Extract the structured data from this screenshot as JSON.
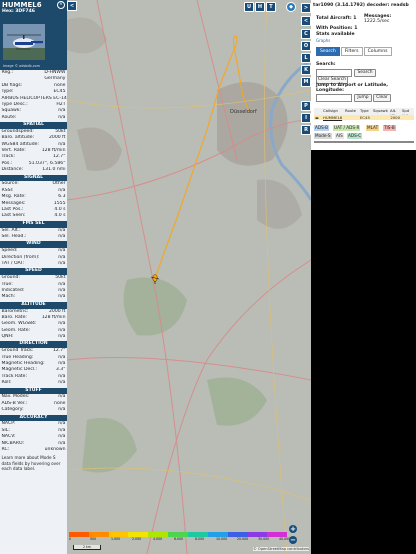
{
  "info": {
    "callsign": "HUMMEL6",
    "hex_label": "Hex:",
    "hex": "3DF746",
    "image_credit": "Image © adsbdb.com",
    "close_glyph": "×",
    "fields": [
      {
        "label": "Reg.:",
        "value": "D-HNWW"
      },
      {
        "label": "",
        "value": "Germany"
      },
      {
        "label": "DB flags:",
        "value": "none"
      },
      {
        "label": "Type:",
        "value": "EC45"
      },
      {
        "label": "AIRBUS HELICOPTERS EC-145",
        "value": ""
      },
      {
        "label": "Type Desc.:",
        "value": "H2T"
      },
      {
        "label": "Squawk:",
        "value": "n/a"
      },
      {
        "label": "Route:",
        "value": "n/a"
      }
    ],
    "sections": [
      {
        "title": "SPATIAL",
        "rows": [
          {
            "label": "Groundspeed:",
            "value": "50kt"
          },
          {
            "label": "Baro. altitude:",
            "value": "2000 ft"
          },
          {
            "label": "WGS84 altitude:",
            "value": "n/a"
          },
          {
            "label": "Vert. Rate:",
            "value": "128 ft/min"
          },
          {
            "label": "Track:",
            "value": "12.7°"
          },
          {
            "label": "Pos.:",
            "value": "51.037°, 6.586°"
          },
          {
            "label": "Distance:",
            "value": "131.0 nmi"
          }
        ]
      },
      {
        "title": "SIGNAL",
        "rows": [
          {
            "label": "Source:",
            "value": "Other"
          },
          {
            "label": "RSSI:",
            "value": "n/a"
          },
          {
            "label": "Msg. Rate:",
            "value": "6.3"
          },
          {
            "label": "Messages:",
            "value": "1555"
          },
          {
            "label": "Last Pos.:",
            "value": "4.0 s"
          },
          {
            "label": "Last Seen:",
            "value": "4.0 s"
          }
        ]
      },
      {
        "title": "FMS SEL",
        "rows": [
          {
            "label": "Sel. Alt.:",
            "value": "n/a"
          },
          {
            "label": "Sel. Head.:",
            "value": "n/a"
          }
        ]
      },
      {
        "title": "WIND",
        "rows": [
          {
            "label": "Speed:",
            "value": "n/a"
          },
          {
            "label": "Direction (from):",
            "value": "n/a"
          },
          {
            "label": "TAT / OAT:",
            "value": "n/a"
          }
        ]
      },
      {
        "title": "SPEED",
        "rows": [
          {
            "label": "Ground:",
            "value": "50kt"
          },
          {
            "label": "True:",
            "value": "n/a"
          },
          {
            "label": "Indicated:",
            "value": "n/a"
          },
          {
            "label": "Mach:",
            "value": "n/a"
          }
        ]
      },
      {
        "title": "ALTITUDE",
        "rows": [
          {
            "label": "Barometric:",
            "value": "2000 ft"
          },
          {
            "label": "Baro. Rate:",
            "value": "128 ft/min"
          },
          {
            "label": "Geom. WGS84:",
            "value": "n/a"
          },
          {
            "label": "Geom. Rate:",
            "value": "n/a"
          },
          {
            "label": "QNH:",
            "value": "n/a"
          }
        ]
      },
      {
        "title": "DIRECTION",
        "rows": [
          {
            "label": "Ground Track:",
            "value": "12.7°"
          },
          {
            "label": "True Heading:",
            "value": "n/a"
          },
          {
            "label": "Magnetic Heading:",
            "value": "n/a"
          },
          {
            "label": "Magnetic Decl.:",
            "value": "3.3°"
          },
          {
            "label": "Track Rate:",
            "value": "n/a"
          },
          {
            "label": "Roll:",
            "value": "n/a"
          }
        ]
      },
      {
        "title": "STUFF",
        "rows": [
          {
            "label": "Nav. Modes:",
            "value": "n/a"
          },
          {
            "label": "ADS-B Ver.:",
            "value": "none"
          },
          {
            "label": "Category:",
            "value": "n/a"
          }
        ]
      },
      {
        "title": "ACCURACY",
        "rows": [
          {
            "label": "NACP:",
            "value": "n/a"
          },
          {
            "label": "SIL:",
            "value": "n/a"
          },
          {
            "label": "NACV:",
            "value": "n/a"
          },
          {
            "label": "NICBARO:",
            "value": "n/a"
          },
          {
            "label": "RC:",
            "value": "unknown"
          }
        ]
      }
    ],
    "learn_more": "Learn more about Mode S data fields by hovering over each data label."
  },
  "map": {
    "top_buttons": [
      "U",
      "H",
      "T"
    ],
    "side_buttons": [
      "C",
      "O",
      "L",
      "K",
      "M",
      "P",
      "I",
      "R"
    ],
    "arrow_left": "<",
    "arrow_right": ">",
    "city_label": "Düsseldorf",
    "colorbar_labels": [
      "0",
      "500",
      "1.000",
      "2.000",
      "4.000",
      "6.000",
      "8.000",
      "10.000",
      "20.000",
      "30.000",
      "40.000+"
    ],
    "colorbar_colors": [
      "#ff5a00",
      "#ff8c00",
      "#ffc400",
      "#f2e600",
      "#aee600",
      "#4dd54d",
      "#1ec8a0",
      "#22a0e6",
      "#3b5fe6",
      "#8a3be6",
      "#d42fd4"
    ],
    "scale_label": "2 km",
    "zoom_in": "+",
    "zoom_out": "−",
    "attribution": "© OpenStreetMap contributors",
    "road_labels": [
      "B 224",
      "B 8",
      "A 52",
      "B 1",
      "B 59",
      "B 477",
      "A 46",
      "B 230",
      "A 61",
      "A 57"
    ]
  },
  "stats": {
    "version_line": "tar1090 (3.14.1792) decoder: readsb",
    "total_aircraft_label": "Total Aircraft:",
    "total_aircraft": "1",
    "messages_label": "Messages:",
    "messages": "1222.5/sec",
    "with_position_label": "With Position:",
    "with_position": "1",
    "stats_available": "Stats available",
    "stats_link": "Graphs",
    "tabs": [
      "Search",
      "Filters",
      "Columns"
    ],
    "search_label": "Search:",
    "search_button": "Search",
    "clear_search_button": "Clear Search",
    "jump_label": "Jump to Airport or Latitude, Longitude:",
    "jump_button": "Jump",
    "clear_button": "Clear",
    "table_headers": [
      "Callsign",
      "Route",
      "Type",
      "Squawk",
      "Alt. (ft)",
      "Spd (kt)"
    ],
    "table_row": [
      "HUMMEL6",
      "EC45",
      "2000"
    ],
    "badges": [
      "ADS-B",
      "UAT / ADS-R",
      "MLAT",
      "TIS-B",
      "Mode-S",
      "AIS",
      "ADS-C"
    ]
  }
}
